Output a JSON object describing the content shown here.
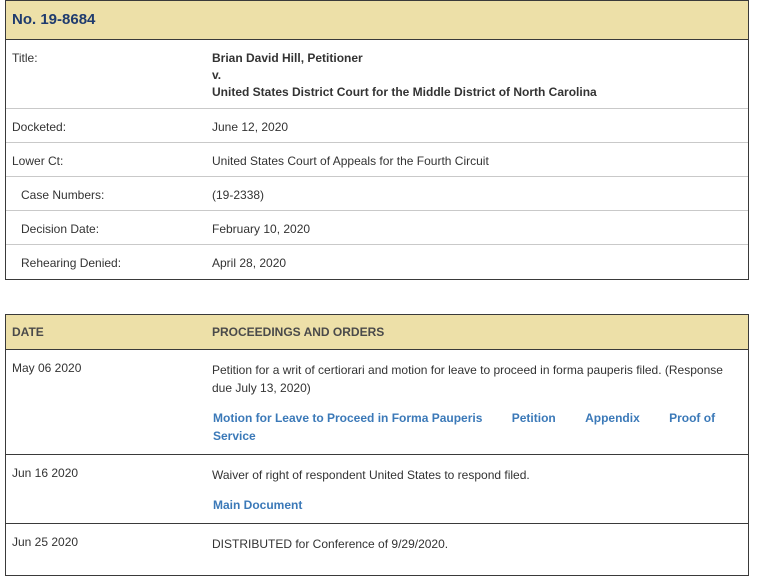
{
  "case": {
    "number": "No. 19-8684",
    "title_label": "Title:",
    "title_lines": [
      "Brian David Hill, Petitioner",
      "v.",
      "United States District Court for the Middle District of North Carolina"
    ],
    "docketed_label": "Docketed:",
    "docketed": "June 12, 2020",
    "lower_ct_label": "Lower Ct:",
    "lower_ct": "United States Court of Appeals for the Fourth Circuit",
    "case_numbers_label": "Case Numbers:",
    "case_numbers": "(19-2338)",
    "decision_date_label": "Decision Date:",
    "decision_date": "February 10, 2020",
    "rehearing_label": "Rehearing Denied:",
    "rehearing": "April 28, 2020"
  },
  "proceedings": {
    "date_header": "DATE",
    "proc_header": "PROCEEDINGS AND ORDERS",
    "entries": [
      {
        "date": "May 06 2020",
        "text": "Petition for a writ of certiorari and motion for leave to proceed in forma pauperis filed. (Response due July 13, 2020)",
        "links": [
          "Motion for Leave to Proceed in Forma Pauperis",
          "Petition",
          "Appendix",
          "Proof of Service"
        ]
      },
      {
        "date": "Jun 16 2020",
        "text": "Waiver of right of respondent United States to respond filed.",
        "links": [
          "Main Document"
        ]
      },
      {
        "date": "Jun 25 2020",
        "text": "DISTRIBUTED for Conference of 9/29/2020.",
        "links": []
      }
    ]
  }
}
